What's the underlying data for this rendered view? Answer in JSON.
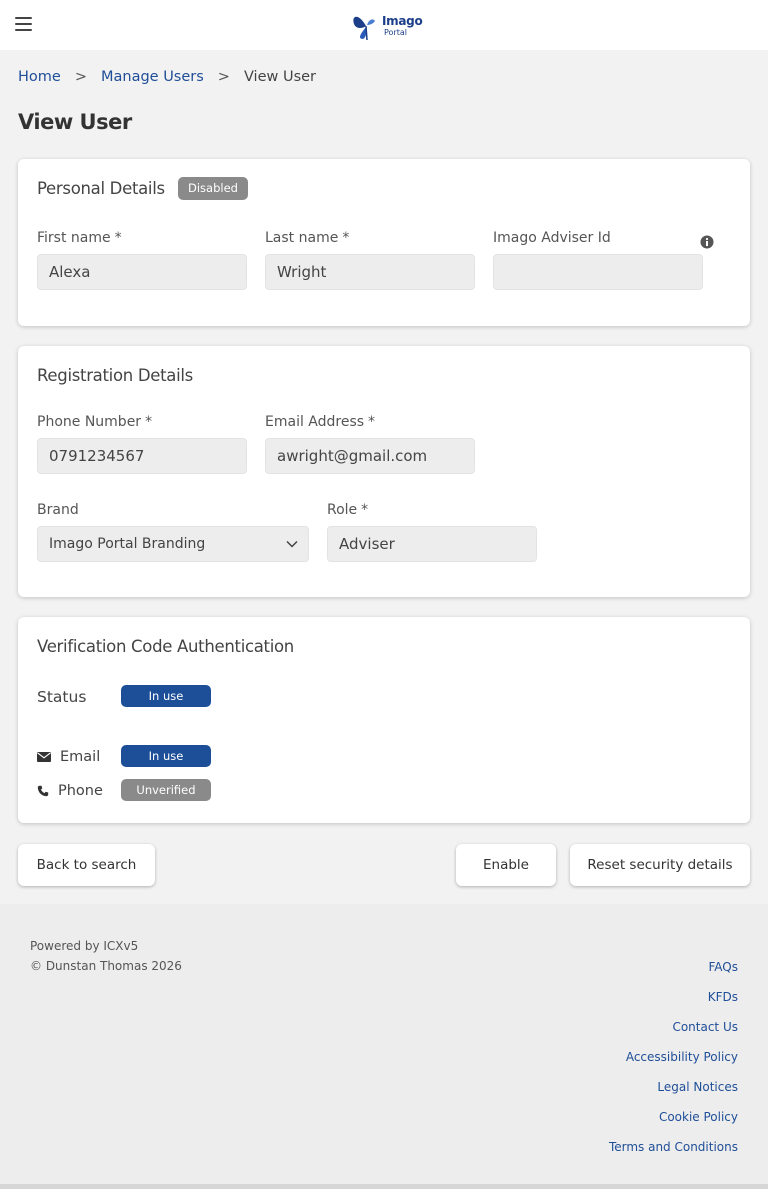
{
  "header": {
    "logo_text": "Imago",
    "logo_sub": "Portal"
  },
  "breadcrumb": {
    "home": "Home",
    "manage_users": "Manage Users",
    "current": "View User",
    "separator": ">"
  },
  "page_title": "View User",
  "personal": {
    "title": "Personal Details",
    "status_badge": "Disabled",
    "first_name_label": "First name",
    "first_name_value": "Alexa",
    "last_name_label": "Last name",
    "last_name_value": "Wright",
    "adviser_id_label": "Imago Adviser Id",
    "adviser_id_value": "",
    "required_mark": "*"
  },
  "registration": {
    "title": "Registration Details",
    "phone_label": "Phone Number",
    "phone_value": "0791234567",
    "email_label": "Email Address",
    "email_value": "awright@gmail.com",
    "brand_label": "Brand",
    "brand_value": "Imago Portal Branding",
    "role_label": "Role",
    "role_value": "Adviser",
    "required_mark": "*"
  },
  "verification": {
    "title": "Verification Code Authentication",
    "status_label": "Status",
    "status_value": "In use",
    "email_label": "Email",
    "email_status": "In use",
    "phone_label": "Phone",
    "phone_status": "Unverified"
  },
  "actions": {
    "back": "Back to search",
    "enable": "Enable",
    "reset": "Reset security details"
  },
  "footer": {
    "powered_by": "Powered by ICXv5",
    "copyright": "© Dunstan Thomas 2026",
    "links": [
      "FAQs",
      "KFDs",
      "Contact Us",
      "Accessibility Policy",
      "Legal Notices",
      "Cookie Policy",
      "Terms and Conditions"
    ]
  },
  "colors": {
    "brand_blue": "#1d4f98",
    "badge_grey": "#8a8a8a",
    "link": "#1f4e98"
  }
}
